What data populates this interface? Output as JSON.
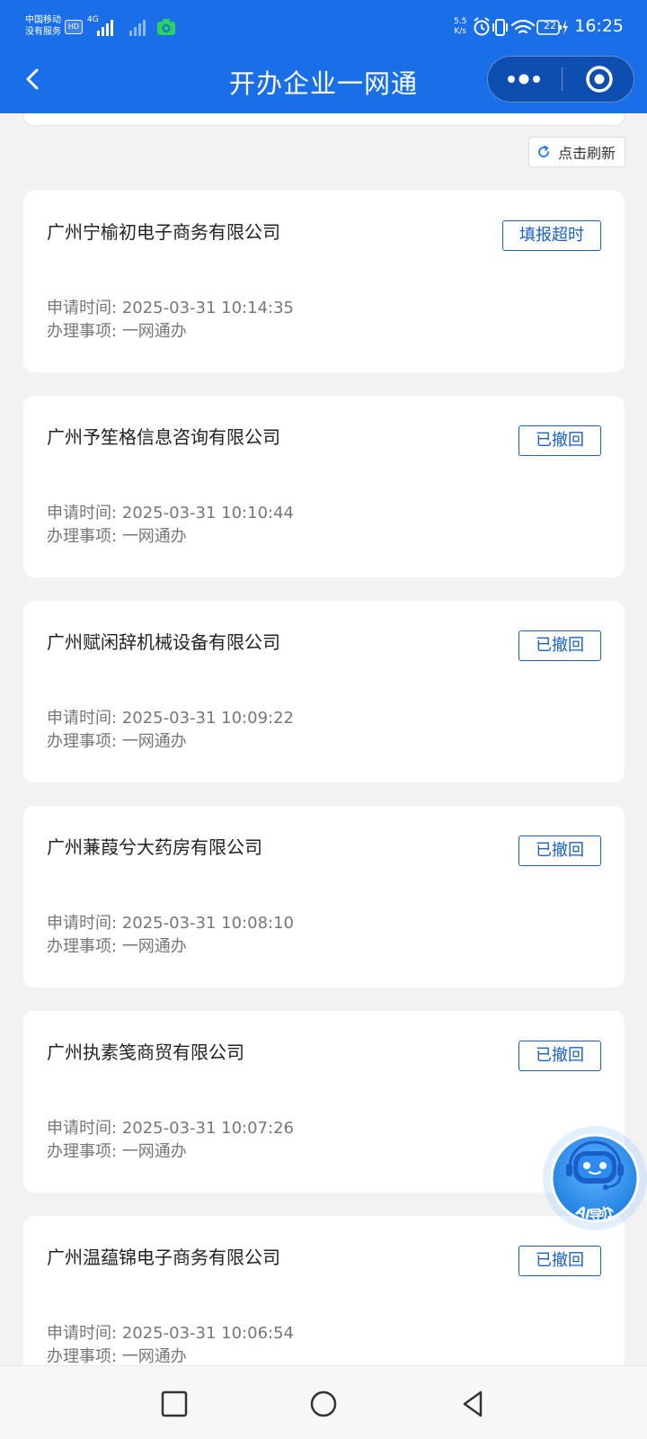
{
  "status_bar": {
    "carrier_line1": "中国移动",
    "carrier_line2": "没有服务",
    "hd_badge": "HD",
    "network_type": "4G",
    "speed_value": "5.5",
    "speed_unit": "K/s",
    "battery_level": "22",
    "time": "16:25"
  },
  "nav": {
    "title": "开办企业一网通"
  },
  "refresh_label": "点击刷新",
  "labels": {
    "apply_time": "申请时间:",
    "item": "办理事项:"
  },
  "applications": [
    {
      "company": "广州宁榆初电子商务有限公司",
      "status": "填报超时",
      "apply_time": "2025-03-31 10:14:35",
      "item": "一网通办"
    },
    {
      "company": "广州予笙格信息咨询有限公司",
      "status": "已撤回",
      "apply_time": "2025-03-31 10:10:44",
      "item": "一网通办"
    },
    {
      "company": "广州赋闲辞机械设备有限公司",
      "status": "已撤回",
      "apply_time": "2025-03-31 10:09:22",
      "item": "一网通办"
    },
    {
      "company": "广州蒹葭兮大药房有限公司",
      "status": "已撤回",
      "apply_time": "2025-03-31 10:08:10",
      "item": "一网通办"
    },
    {
      "company": "广州执素笺商贸有限公司",
      "status": "已撤回",
      "apply_time": "2025-03-31 10:07:26",
      "item": "一网通办"
    },
    {
      "company": "广州温蕴锦电子商务有限公司",
      "status": "已撤回",
      "apply_time": "2025-03-31 10:06:54",
      "item": "一网通办"
    }
  ],
  "ai_guide_label": "AI导办",
  "colors": {
    "header": "#1a6ee8",
    "badge": "#1a5fc7",
    "background": "#f2f2f2"
  },
  "icons": {
    "back": "chevron-left-icon",
    "more": "more-dots-icon",
    "close": "target-circle-icon",
    "refresh": "refresh-icon",
    "ai": "robot-headset-icon"
  }
}
